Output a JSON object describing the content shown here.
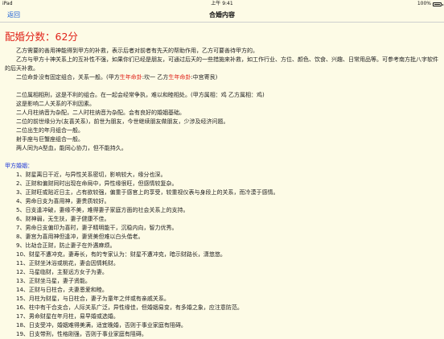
{
  "status_bar": {
    "left": "iPad",
    "time": "上午 9:41",
    "battery": "100%"
  },
  "nav": {
    "back_label": "返回",
    "title": "合婚内容"
  },
  "score": {
    "label": "配婚分数：",
    "value": "62分"
  },
  "intro": [
    "乙方需要的善用神能得到甲方的补救，表示后者对前者有先天的帮助作用，乙方可要善待甲方的。",
    "乙方与甲方十神关系上的互补性不强，如果你们已经是朋友，可通过后天的一些措施来补救，如工作行业、方位、颜色、饮食、兴趣、日常用品等。可参考南方批八字软件的后天补救。"
  ],
  "palace": {
    "prefix": "二位命卦没有固定组合，关系一般。(甲方",
    "a_label": "生年命卦",
    "a_value": ":坎一 乙方",
    "b_label": "生年命卦",
    "b_value": ":中宫寄艮)"
  },
  "analysis": [
    "二位属相相刑，这是不利的组合。在一起会经常争执，难以和睦相处。(甲方属相：鸡 乙方属相：鸡)",
    "这是影响二人关系的不利因素。",
    "二人月柱纳音为杂配，二人时柱纳音为杂配。会有良好的婚姻基础。",
    "二位的前世缘分为(友喜关系)，前世为朋友，今世继续朋友做朋友，少涉及经济问题。",
    "二位出生的年月组合一般。",
    "射手座与巨蟹座组合一般。",
    "两人同为A型血，能同心协力，但不能持久。"
  ],
  "section": {
    "title": "甲方婚姻："
  },
  "items": [
    "1、财星离日干近，与异性关系密切，影响较大，缘分也深。",
    "2、正财和偏财同时出现在命局中，异性缘很旺，但感情较复杂。",
    "3、正财旺或贴近日主，占有欲较强，偏重于感官上的享受，较重视仪表与身段上的关系，而冷漠于感情。",
    "4、男命日支为喜用神，妻贵质较好。",
    "5、日支逢冲破，妻缘不美，难得妻子家庭方面的社会关系上的支持。",
    "6、财神弱，无生扶，妻子健康不佳。",
    "7、男命日支偏印为喜时，妻子精明能干，沉稳内向，智力优秀。",
    "8、妻宫为喜用神但逢冲，妻贤美但难以白头偕老。",
    "9、比劫合正财，防止妻子在外遇麻烦。",
    "10、财星不遭冲克，妻寿长，有的专家认为：财星不遭冲克，暗示财路长，潇悠悠。",
    "11、正财坐沐浴或桃花，妻会因情耗财。",
    "12、马星临财，主娶远方女子为妻。",
    "13、正财坐马星，妻子贤能。",
    "14、正财与日柱合，夫妻恩爱和睦。",
    "15、月柱为财星，与日柱合，妻子为童年之伴或有亲戚关系。",
    "16、柱中有干合支合，人际关系广泛，异性缘佳，但婚姻易变，有多婚之象，应注意防范。",
    "17、男命财星在年月柱，易早婚或选婚。",
    "18、日支受冲，婚姻难得美满，适宜晚婚，否则于事业家庭有阻碍。",
    "19、日支带刑，性格刚强，否则于事业家庭有阻碍。"
  ]
}
